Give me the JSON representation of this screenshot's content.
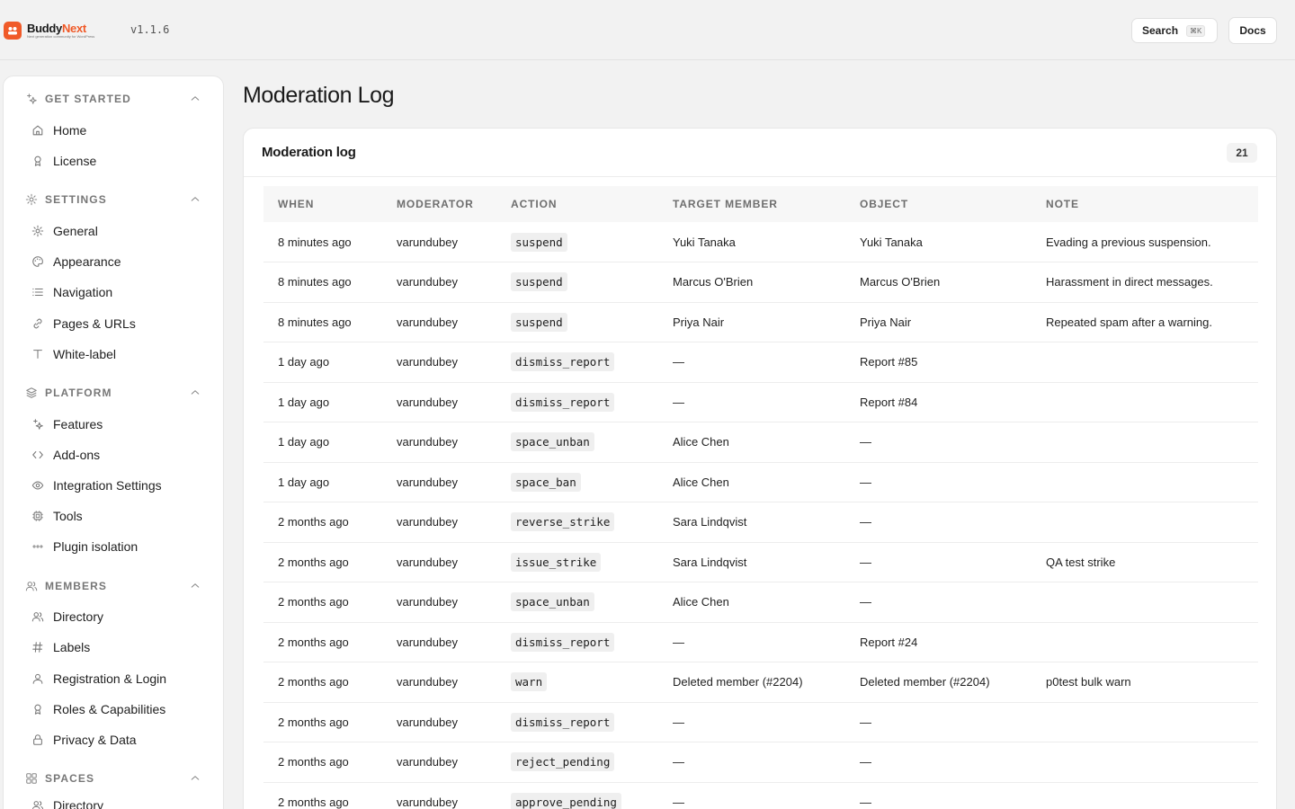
{
  "app": {
    "name_prefix": "Buddy",
    "name_suffix": "Next",
    "tagline": "Next generation community for WordPress",
    "version": "v1.1.6"
  },
  "topbar": {
    "search_label": "Search",
    "search_shortcut": "⌘K",
    "docs_label": "Docs"
  },
  "sidebar": {
    "sections": [
      {
        "title": "GET STARTED",
        "icon": "sparkles-icon",
        "items": [
          {
            "label": "Home",
            "icon": "home-icon"
          },
          {
            "label": "License",
            "icon": "badge-icon"
          }
        ]
      },
      {
        "title": "SETTINGS",
        "icon": "gear-icon",
        "items": [
          {
            "label": "General",
            "icon": "gear-icon"
          },
          {
            "label": "Appearance",
            "icon": "palette-icon"
          },
          {
            "label": "Navigation",
            "icon": "list-icon"
          },
          {
            "label": "Pages & URLs",
            "icon": "link-icon"
          },
          {
            "label": "White-label",
            "icon": "type-icon"
          }
        ]
      },
      {
        "title": "PLATFORM",
        "icon": "layers-icon",
        "items": [
          {
            "label": "Features",
            "icon": "sparkles-icon"
          },
          {
            "label": "Add-ons",
            "icon": "code-icon"
          },
          {
            "label": "Integration Settings",
            "icon": "eye-icon"
          },
          {
            "label": "Tools",
            "icon": "cpu-icon"
          },
          {
            "label": "Plugin isolation",
            "icon": "dots-icon"
          }
        ]
      },
      {
        "title": "MEMBERS",
        "icon": "users-icon",
        "items": [
          {
            "label": "Directory",
            "icon": "users-icon"
          },
          {
            "label": "Labels",
            "icon": "hash-icon"
          },
          {
            "label": "Registration & Login",
            "icon": "user-icon"
          },
          {
            "label": "Roles & Capabilities",
            "icon": "badge-icon"
          },
          {
            "label": "Privacy & Data",
            "icon": "lock-icon"
          }
        ]
      },
      {
        "title": "SPACES",
        "icon": "grid-icon",
        "items": [
          {
            "label": "Directory",
            "icon": "users-icon"
          }
        ]
      }
    ]
  },
  "main": {
    "page_title": "Moderation Log",
    "card_title": "Moderation log",
    "count": "21",
    "columns": [
      "WHEN",
      "MODERATOR",
      "ACTION",
      "TARGET MEMBER",
      "OBJECT",
      "NOTE"
    ],
    "rows": [
      {
        "when": "8 minutes ago",
        "moderator": "varundubey",
        "action": "suspend",
        "target": "Yuki Tanaka",
        "object": "Yuki Tanaka",
        "note": "Evading a previous suspension."
      },
      {
        "when": "8 minutes ago",
        "moderator": "varundubey",
        "action": "suspend",
        "target": "Marcus O'Brien",
        "object": "Marcus O'Brien",
        "note": "Harassment in direct messages."
      },
      {
        "when": "8 minutes ago",
        "moderator": "varundubey",
        "action": "suspend",
        "target": "Priya Nair",
        "object": "Priya Nair",
        "note": "Repeated spam after a warning."
      },
      {
        "when": "1 day ago",
        "moderator": "varundubey",
        "action": "dismiss_report",
        "target": "—",
        "object": "Report #85",
        "note": ""
      },
      {
        "when": "1 day ago",
        "moderator": "varundubey",
        "action": "dismiss_report",
        "target": "—",
        "object": "Report #84",
        "note": ""
      },
      {
        "when": "1 day ago",
        "moderator": "varundubey",
        "action": "space_unban",
        "target": "Alice Chen",
        "object": "—",
        "note": ""
      },
      {
        "when": "1 day ago",
        "moderator": "varundubey",
        "action": "space_ban",
        "target": "Alice Chen",
        "object": "—",
        "note": ""
      },
      {
        "when": "2 months ago",
        "moderator": "varundubey",
        "action": "reverse_strike",
        "target": "Sara Lindqvist",
        "object": "—",
        "note": ""
      },
      {
        "when": "2 months ago",
        "moderator": "varundubey",
        "action": "issue_strike",
        "target": "Sara Lindqvist",
        "object": "—",
        "note": "QA test strike"
      },
      {
        "when": "2 months ago",
        "moderator": "varundubey",
        "action": "space_unban",
        "target": "Alice Chen",
        "object": "—",
        "note": ""
      },
      {
        "when": "2 months ago",
        "moderator": "varundubey",
        "action": "dismiss_report",
        "target": "—",
        "object": "Report #24",
        "note": ""
      },
      {
        "when": "2 months ago",
        "moderator": "varundubey",
        "action": "warn",
        "target": "Deleted member (#2204)",
        "object": "Deleted member (#2204)",
        "note": "p0test bulk warn"
      },
      {
        "when": "2 months ago",
        "moderator": "varundubey",
        "action": "dismiss_report",
        "target": "—",
        "object": "—",
        "note": ""
      },
      {
        "when": "2 months ago",
        "moderator": "varundubey",
        "action": "reject_pending",
        "target": "—",
        "object": "—",
        "note": ""
      },
      {
        "when": "2 months ago",
        "moderator": "varundubey",
        "action": "approve_pending",
        "target": "—",
        "object": "—",
        "note": ""
      }
    ]
  }
}
